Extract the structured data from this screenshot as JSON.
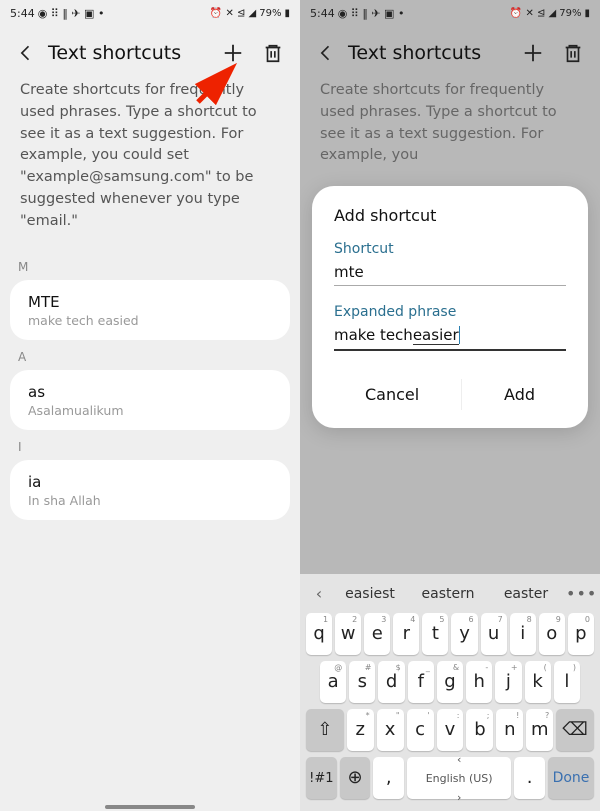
{
  "status": {
    "time": "5:44",
    "battery": "79%"
  },
  "header": {
    "title": "Text shortcuts"
  },
  "description": "Create shortcuts for frequently used phrases. Type a shortcut to see it as a text suggestion. For example, you could set \"example@samsung.com\" to be suggested whenever you type \"email.\"",
  "description_short": "Create shortcuts for frequently used phrases. Type a shortcut to see it as a text suggestion. For example, you",
  "sections": [
    {
      "label": "M",
      "items": [
        {
          "title": "MTE",
          "sub": "make tech easied"
        }
      ]
    },
    {
      "label": "A",
      "items": [
        {
          "title": "as",
          "sub": "Asalamualikum"
        }
      ]
    },
    {
      "label": "I",
      "items": [
        {
          "title": "ia",
          "sub": "In sha Allah"
        }
      ]
    }
  ],
  "dialog": {
    "title": "Add shortcut",
    "shortcut_label": "Shortcut",
    "shortcut_value": "mte",
    "expanded_label": "Expanded phrase",
    "expanded_value_pre": "make tech ",
    "expanded_value_ul": "easier",
    "cancel": "Cancel",
    "add": "Add"
  },
  "keyboard": {
    "suggestions": [
      "easiest",
      "eastern",
      "easter"
    ],
    "row1": [
      {
        "m": "q",
        "a": "1"
      },
      {
        "m": "w",
        "a": "2"
      },
      {
        "m": "e",
        "a": "3"
      },
      {
        "m": "r",
        "a": "4"
      },
      {
        "m": "t",
        "a": "5"
      },
      {
        "m": "y",
        "a": "6"
      },
      {
        "m": "u",
        "a": "7"
      },
      {
        "m": "i",
        "a": "8"
      },
      {
        "m": "o",
        "a": "9"
      },
      {
        "m": "p",
        "a": "0"
      }
    ],
    "row2": [
      {
        "m": "a",
        "a": "@"
      },
      {
        "m": "s",
        "a": "#"
      },
      {
        "m": "d",
        "a": "$"
      },
      {
        "m": "f",
        "a": "_"
      },
      {
        "m": "g",
        "a": "&"
      },
      {
        "m": "h",
        "a": "-"
      },
      {
        "m": "j",
        "a": "+"
      },
      {
        "m": "k",
        "a": "("
      },
      {
        "m": "l",
        "a": ")"
      }
    ],
    "row3": [
      {
        "m": "z",
        "a": "*"
      },
      {
        "m": "x",
        "a": "\""
      },
      {
        "m": "c",
        "a": "'"
      },
      {
        "m": "v",
        "a": ":"
      },
      {
        "m": "b",
        "a": ";"
      },
      {
        "m": "n",
        "a": "!"
      },
      {
        "m": "m",
        "a": "?"
      }
    ],
    "sym": "!#1",
    "comma": ",",
    "period": ".",
    "space": "English (US)",
    "done": "Done"
  }
}
